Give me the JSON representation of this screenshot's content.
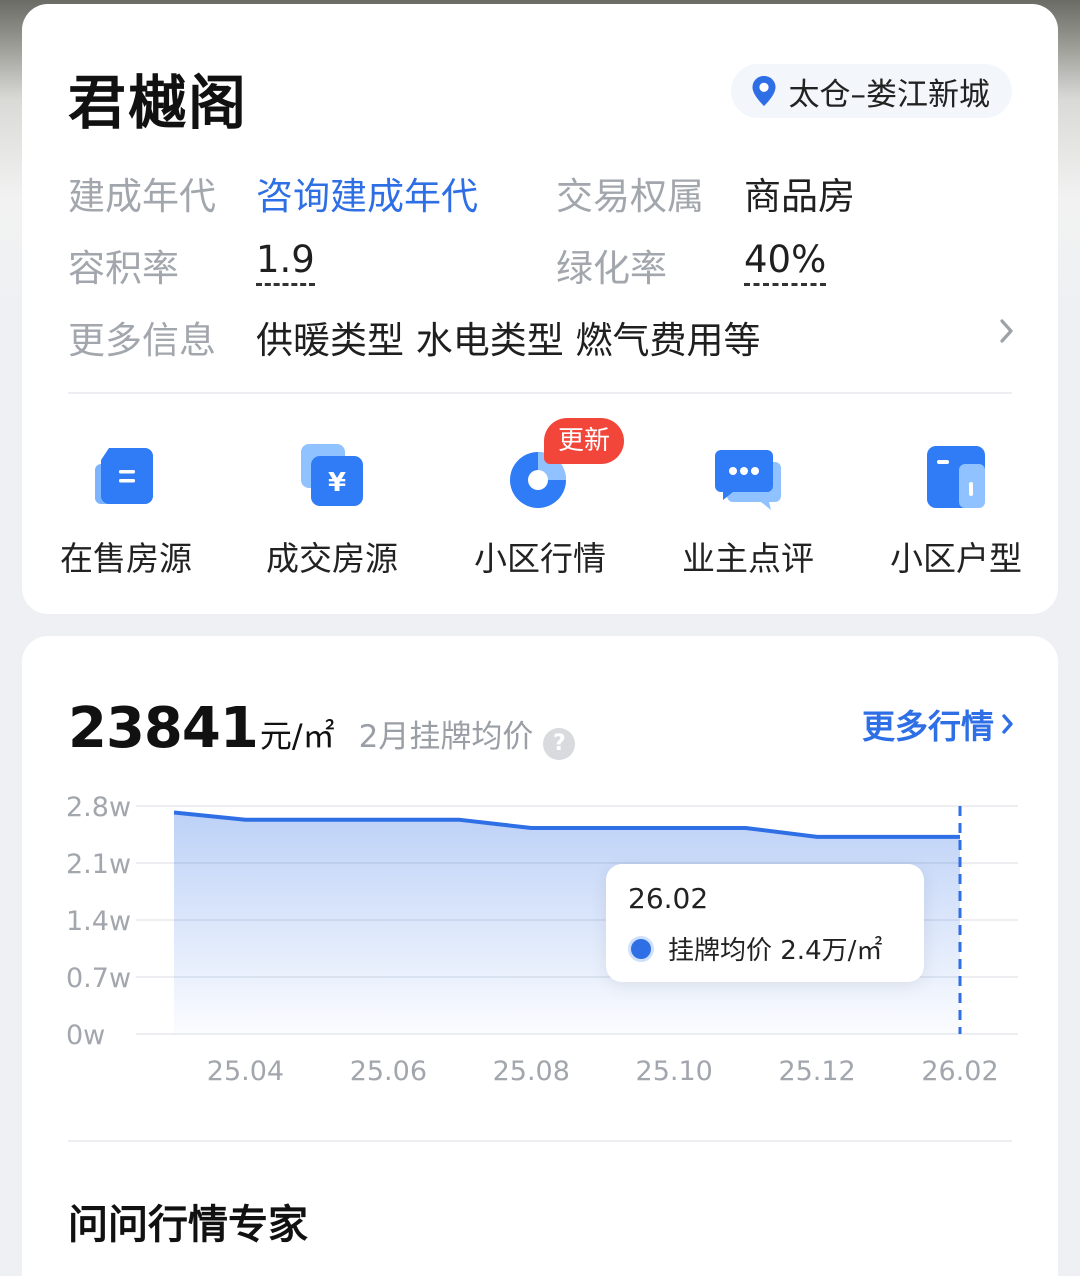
{
  "community": {
    "name": "君樾阁",
    "location": "太仓–娄江新城"
  },
  "info": {
    "build_year_label": "建成年代",
    "build_year_value": "咨询建成年代",
    "ownership_label": "交易权属",
    "ownership_value": "商品房",
    "plot_ratio_label": "容积率",
    "plot_ratio_value": "1.9",
    "green_rate_label": "绿化率",
    "green_rate_value": "40%",
    "more_label": "更多信息",
    "more_value": "供暖类型 水电类型 燃气费用等"
  },
  "entries": [
    {
      "label": "在售房源",
      "icon": "listing-icon"
    },
    {
      "label": "成交房源",
      "icon": "deal-icon"
    },
    {
      "label": "小区行情",
      "icon": "market-icon",
      "badge": "更新"
    },
    {
      "label": "业主点评",
      "icon": "review-icon"
    },
    {
      "label": "小区户型",
      "icon": "layout-icon"
    }
  ],
  "price": {
    "value": "23841",
    "unit": "元/㎡",
    "desc": "2月挂牌均价",
    "more": "更多行情"
  },
  "chart_data": {
    "type": "area",
    "x": [
      "25.03",
      "25.04",
      "25.05",
      "25.06",
      "25.07",
      "25.08",
      "25.09",
      "25.10",
      "25.11",
      "25.12",
      "26.01",
      "26.02"
    ],
    "x_tick_labels": [
      "25.04",
      "25.06",
      "25.08",
      "25.10",
      "25.12",
      "26.02"
    ],
    "series": [
      {
        "name": "挂牌均价",
        "values": [
          2.72,
          2.63,
          2.63,
          2.63,
          2.63,
          2.53,
          2.53,
          2.53,
          2.53,
          2.42,
          2.42,
          2.42
        ]
      }
    ],
    "y_ticks": [
      "0w",
      "0.7w",
      "1.4w",
      "2.1w",
      "2.8w"
    ],
    "ylim": [
      0,
      2.8
    ],
    "grid": true,
    "color": "#2f6fe6",
    "tooltip": {
      "date": "26.02",
      "label": "挂牌均价 2.4万/㎡"
    }
  },
  "expert_title": "问问行情专家"
}
